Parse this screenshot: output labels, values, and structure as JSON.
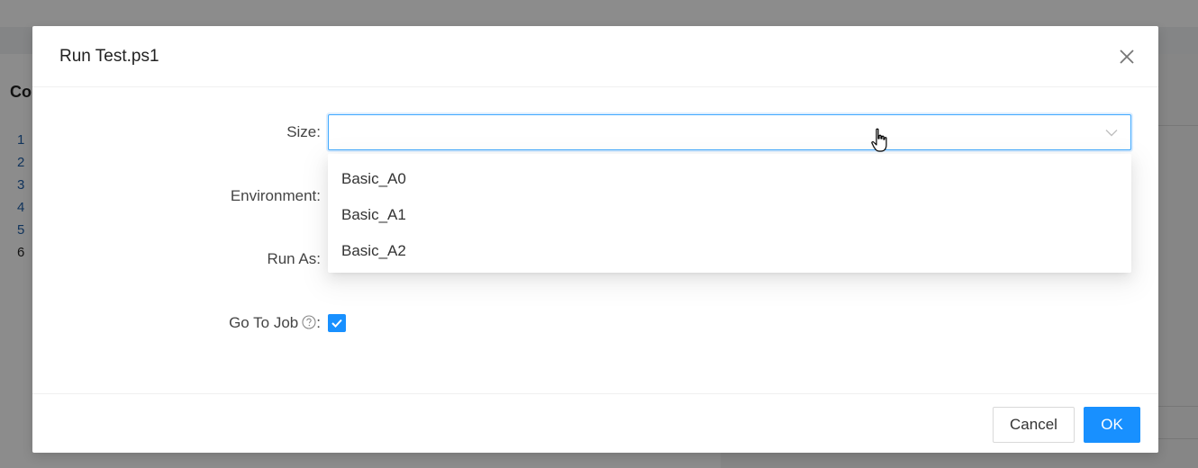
{
  "background": {
    "left_title": "Co",
    "line_numbers": [
      "1",
      "2",
      "3",
      "4",
      "5",
      "6"
    ]
  },
  "modal": {
    "title": "Run Test.ps1",
    "close_icon": "close-icon",
    "fields": {
      "size_label": "Size",
      "environment_label": "Environment",
      "run_as_label": "Run As",
      "go_to_job_label": "Go To Job",
      "colon": ":"
    },
    "size_select": {
      "value": "",
      "options": [
        "Basic_A0",
        "Basic_A1",
        "Basic_A2"
      ]
    },
    "go_to_job_checked": true,
    "footer": {
      "cancel_label": "Cancel",
      "ok_label": "OK"
    }
  },
  "colors": {
    "primary": "#1890ff",
    "focus_border": "#40a9ff"
  }
}
